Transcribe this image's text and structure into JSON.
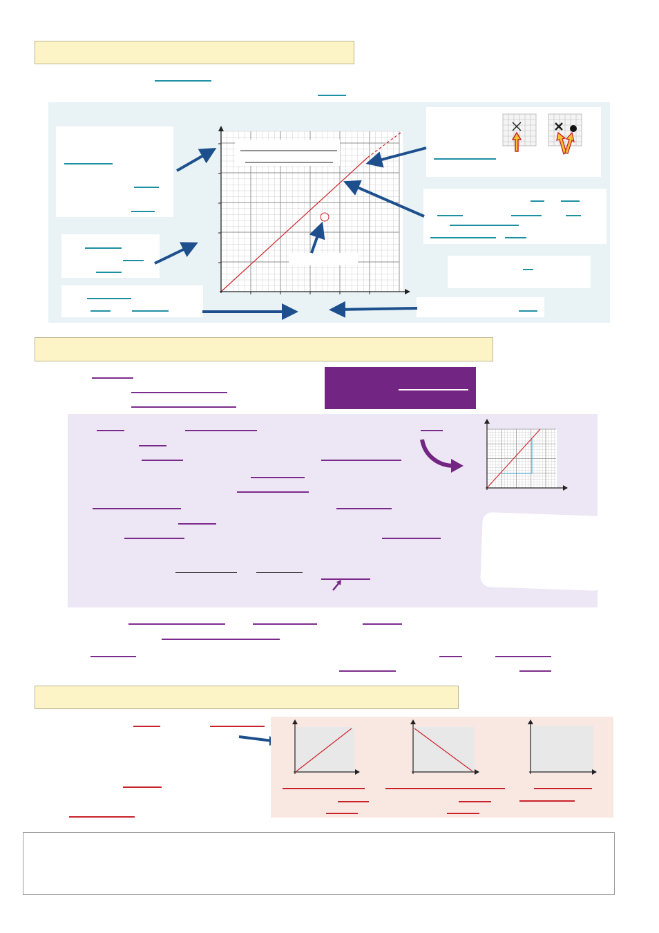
{
  "sections": {
    "s1_header": "",
    "s2_header": "",
    "s3_header": ""
  },
  "main_graph": {
    "title_line1": "",
    "title_line2": "",
    "point_note": ""
  },
  "callouts": {
    "left_top": "",
    "left_mid": "",
    "left_bottom": "",
    "right_top": "",
    "right_mid": "",
    "right_lower": "",
    "right_bottom": ""
  },
  "purple_banner": "",
  "white_note": "",
  "footer_note": "",
  "colors": {
    "header_fill": "#fcf4c6",
    "section1_panel": "#e9f3f6",
    "section2_panel": "#ede6f4",
    "section3_panel": "#f9e8e2",
    "teal_line": "#1d8fa3",
    "purple_line": "#7a2a8a",
    "red_line": "#c8212a",
    "arrow_blue": "#1c4f8c",
    "arrow_purple": "#722582"
  },
  "icons": {
    "cross_marker": "cross-icon",
    "dot_marker": "dot-icon",
    "pointer_arrow": "arrow-icon"
  }
}
